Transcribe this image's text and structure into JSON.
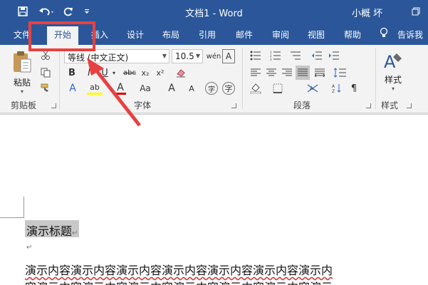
{
  "title_bar": {
    "doc_title": "文档1 - Word",
    "user": "小概 坏",
    "qat_icons": [
      "save-icon",
      "undo-icon",
      "redo-icon",
      "customize-qat-icon"
    ],
    "window_icon": "restore-window-icon"
  },
  "tabs": [
    {
      "label": "文件",
      "active": false
    },
    {
      "label": "开始",
      "active": true
    },
    {
      "label": "插入",
      "active": false
    },
    {
      "label": "设计",
      "active": false
    },
    {
      "label": "布局",
      "active": false
    },
    {
      "label": "引用",
      "active": false
    },
    {
      "label": "邮件",
      "active": false
    },
    {
      "label": "审阅",
      "active": false
    },
    {
      "label": "视图",
      "active": false
    },
    {
      "label": "帮助",
      "active": false
    }
  ],
  "tell_me": "告诉我",
  "ribbon": {
    "clipboard": {
      "paste_label": "粘贴",
      "group_label": "剪贴板"
    },
    "font": {
      "font_name": "等线 (中文正文)",
      "font_size": "10.5",
      "group_label": "字体",
      "format_buttons": [
        "B",
        "I",
        "U",
        "abc",
        "x₂",
        "x²"
      ],
      "style_buttons": [
        "A",
        "ab",
        "A",
        "Aa",
        "A",
        "A"
      ]
    },
    "paragraph": {
      "group_label": "段落"
    },
    "styles": {
      "label": "样式",
      "group_label": "样式"
    }
  },
  "document": {
    "heading": "演示标题",
    "body_line_1": "演示内容演示内容演示内容演示内容演示内容演示内容演示内",
    "body_line_2": "容演示内容演示内容演示内容演示内容演示内容演示内容演示",
    "para_mark": "↵"
  },
  "colors": {
    "brand_blue": "#2b579a",
    "ribbon_bg": "#f3f3f3",
    "annotation_red": "#e84141",
    "spellcheck_red": "#d83b3b"
  }
}
